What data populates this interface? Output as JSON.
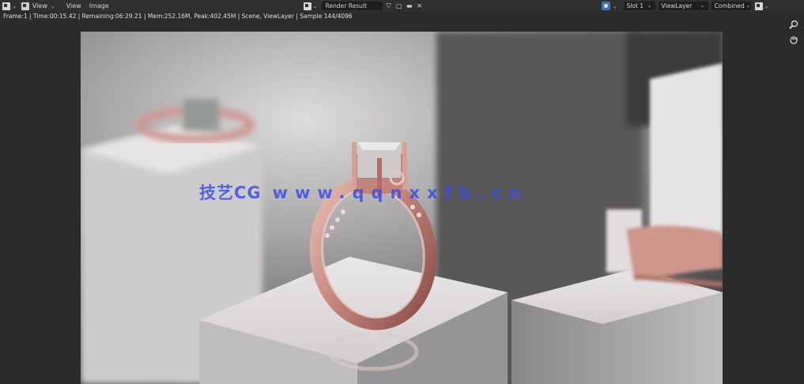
{
  "header": {
    "menus": [
      "View",
      "View",
      "Image"
    ],
    "image_name": "Render Result",
    "slot": "Slot 1",
    "view_layer": "ViewLayer",
    "pass": "Combined"
  },
  "status": {
    "text": "Frame:1 | Time:00:15.42 | Remaining:06:29.21 | Mem:252.16M, Peak:402.45M | Scene, ViewLayer | Sample 144/4096"
  },
  "watermark": {
    "cn": "技艺CG",
    "url": "www.qqnxxfb.cn"
  },
  "icons": {
    "editor_type": "image-editor-icon",
    "view_mode": "view-mode-icon",
    "browse": "browse-image-icon",
    "shield": "fake-user-shield-icon",
    "new": "new-image-icon",
    "folder": "open-folder-icon",
    "close": "close-icon",
    "overlay": "overlay-icon",
    "gizmo": "gizmo-icon",
    "zoom": "zoom-icon",
    "hand": "hand-pan-icon"
  },
  "colors": {
    "header_bg": "#303030",
    "viewport_bg": "#2b2b2b",
    "accent_blue": "#4772b3",
    "watermark": "#3d4fe0"
  }
}
